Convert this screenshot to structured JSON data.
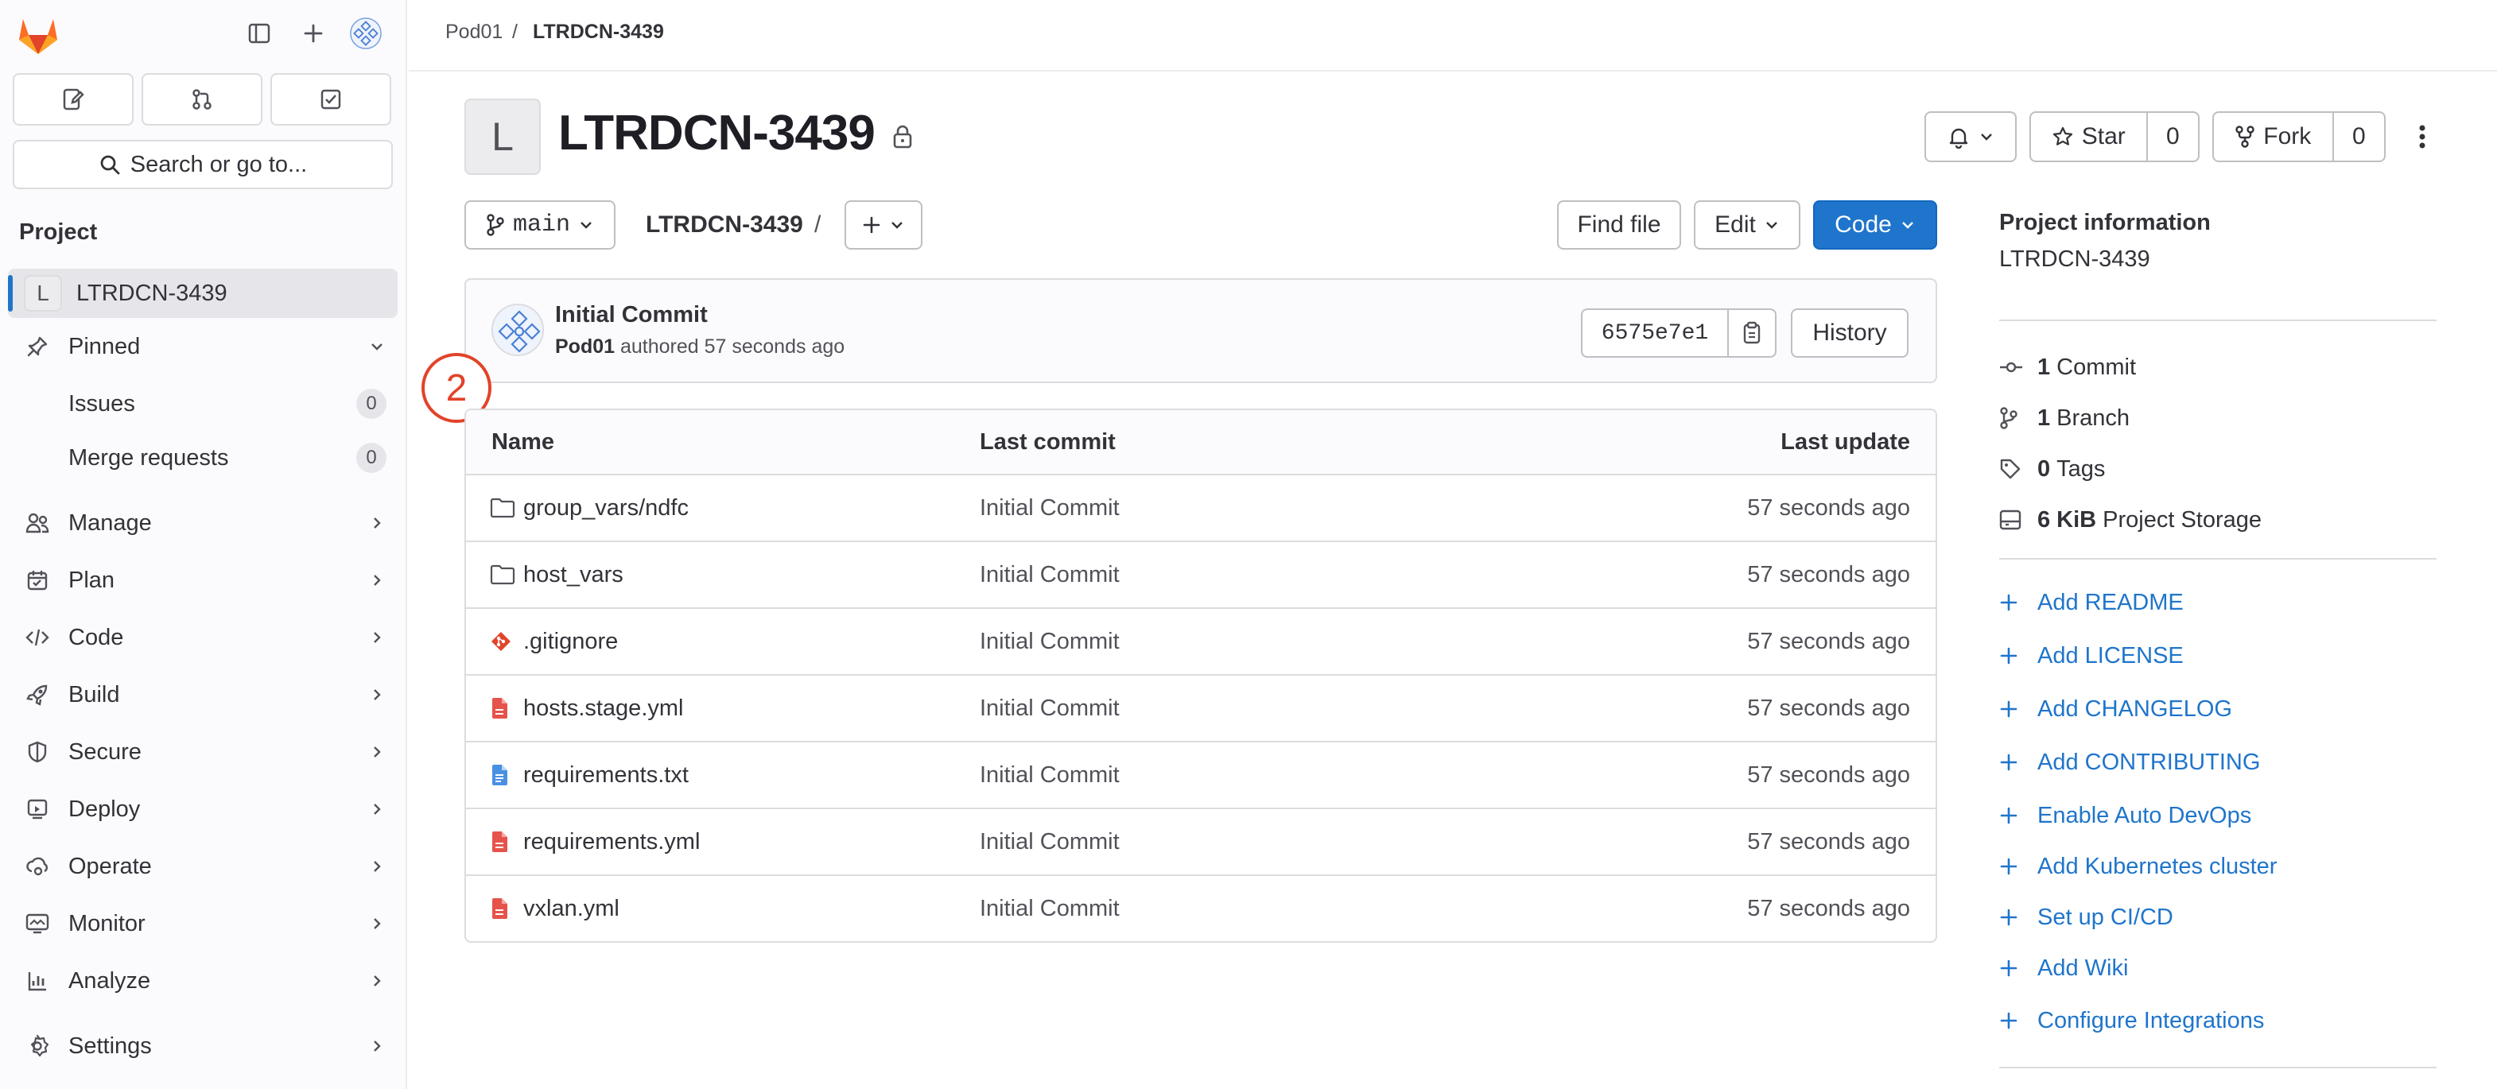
{
  "sidebar": {
    "search_label": "Search or go to...",
    "section_heading": "Project",
    "project_initial": "L",
    "project_name": "LTRDCN-3439",
    "pinned_label": "Pinned",
    "pinned_items": [
      {
        "label": "Issues",
        "count": "0"
      },
      {
        "label": "Merge requests",
        "count": "0"
      }
    ],
    "nav": [
      {
        "label": "Manage",
        "icon": "users-icon"
      },
      {
        "label": "Plan",
        "icon": "calendar-icon"
      },
      {
        "label": "Code",
        "icon": "code-icon"
      },
      {
        "label": "Build",
        "icon": "rocket-icon"
      },
      {
        "label": "Secure",
        "icon": "shield-icon"
      },
      {
        "label": "Deploy",
        "icon": "deploy-icon"
      },
      {
        "label": "Operate",
        "icon": "cloud-gear-icon"
      },
      {
        "label": "Monitor",
        "icon": "monitor-icon"
      },
      {
        "label": "Analyze",
        "icon": "chart-icon"
      }
    ],
    "settings_label": "Settings"
  },
  "breadcrumb": {
    "group": "Pod01",
    "separator": "/",
    "project": "LTRDCN-3439"
  },
  "header": {
    "avatar_letter": "L",
    "title": "LTRDCN-3439",
    "star_label": "Star",
    "star_count": "0",
    "fork_label": "Fork",
    "fork_count": "0"
  },
  "toolbar": {
    "branch": "main",
    "path_root": "LTRDCN-3439",
    "path_sep": "/",
    "find_file": "Find file",
    "edit": "Edit",
    "code": "Code"
  },
  "last_commit": {
    "title": "Initial Commit",
    "author": "Pod01",
    "meta": "authored 57 seconds ago",
    "sha": "6575e7e1",
    "history": "History"
  },
  "step_badge": "2",
  "file_table": {
    "headers": {
      "name": "Name",
      "commit": "Last commit",
      "update": "Last update"
    },
    "rows": [
      {
        "name": "group_vars/ndfc",
        "type": "folder",
        "commit": "Initial Commit",
        "update": "57 seconds ago"
      },
      {
        "name": "host_vars",
        "type": "folder",
        "commit": "Initial Commit",
        "update": "57 seconds ago"
      },
      {
        "name": ".gitignore",
        "type": "git",
        "commit": "Initial Commit",
        "update": "57 seconds ago"
      },
      {
        "name": "hosts.stage.yml",
        "type": "yaml",
        "commit": "Initial Commit",
        "update": "57 seconds ago"
      },
      {
        "name": "requirements.txt",
        "type": "text",
        "commit": "Initial Commit",
        "update": "57 seconds ago"
      },
      {
        "name": "requirements.yml",
        "type": "yaml",
        "commit": "Initial Commit",
        "update": "57 seconds ago"
      },
      {
        "name": "vxlan.yml",
        "type": "yaml",
        "commit": "Initial Commit",
        "update": "57 seconds ago"
      }
    ]
  },
  "project_info": {
    "title": "Project information",
    "name": "LTRDCN-3439",
    "stats": [
      {
        "count": "1",
        "label": "Commit",
        "icon": "commit-icon"
      },
      {
        "count": "1",
        "label": "Branch",
        "icon": "branch-icon"
      },
      {
        "count": "0",
        "label": "Tags",
        "icon": "tag-icon"
      },
      {
        "count": "6 KiB",
        "label": "Project Storage",
        "icon": "storage-icon"
      }
    ],
    "actions": [
      "Add README",
      "Add LICENSE",
      "Add CHANGELOG",
      "Add CONTRIBUTING",
      "Enable Auto DevOps",
      "Add Kubernetes cluster",
      "Set up CI/CD",
      "Add Wiki",
      "Configure Integrations"
    ]
  },
  "colors": {
    "accent": "#1f75cb",
    "brand_orange": "#e24329",
    "sidebar_bg": "#fbfafd",
    "yaml_icon": "#dd2b0e",
    "text_icon": "#1f75cb"
  }
}
